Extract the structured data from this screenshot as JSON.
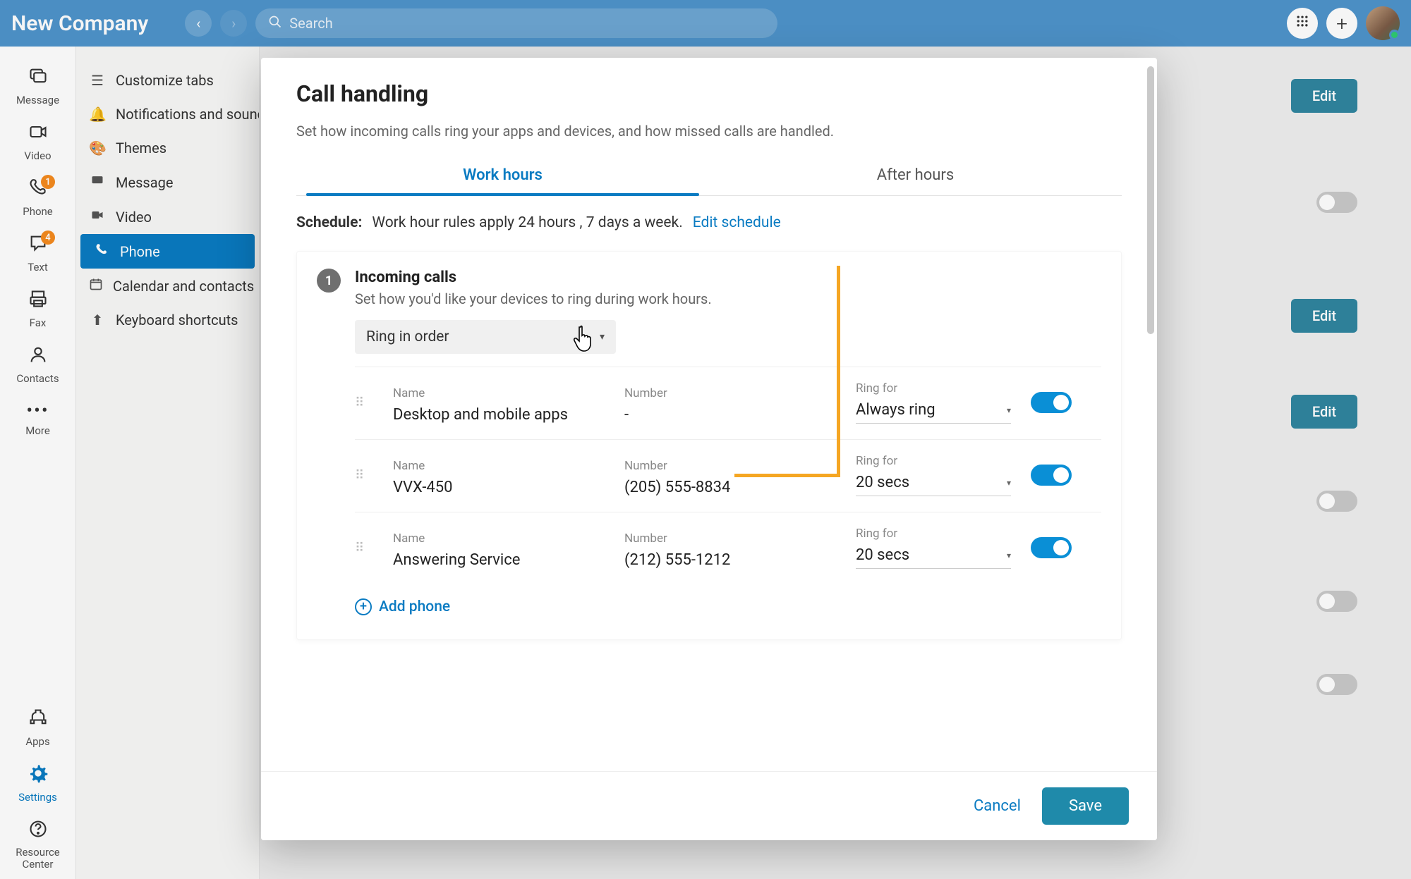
{
  "colors": {
    "accent": "#0a7bc2",
    "header": "#4f94cb",
    "warning": "#f58b1f",
    "highlight": "#f5a623"
  },
  "header": {
    "company_name": "New Company",
    "search_placeholder": "Search"
  },
  "rail": {
    "items": [
      {
        "id": "message",
        "label": "Message",
        "badge": null
      },
      {
        "id": "video",
        "label": "Video",
        "badge": null
      },
      {
        "id": "phone",
        "label": "Phone",
        "badge": "1"
      },
      {
        "id": "text",
        "label": "Text",
        "badge": "4"
      },
      {
        "id": "fax",
        "label": "Fax",
        "badge": null
      },
      {
        "id": "contacts",
        "label": "Contacts",
        "badge": null
      },
      {
        "id": "more",
        "label": "More",
        "badge": null
      }
    ],
    "bottom": [
      {
        "id": "apps",
        "label": "Apps"
      },
      {
        "id": "settings",
        "label": "Settings"
      },
      {
        "id": "resource",
        "label": "Resource Center"
      }
    ]
  },
  "sidebar": {
    "items": [
      {
        "label": "Customize tabs"
      },
      {
        "label": "Notifications and sounds"
      },
      {
        "label": "Themes"
      },
      {
        "label": "Message"
      },
      {
        "label": "Video"
      },
      {
        "label": "Phone"
      },
      {
        "label": "Calendar and contacts"
      },
      {
        "label": "Keyboard shortcuts"
      }
    ],
    "active_index": 5
  },
  "bg_page": {
    "edit_label": "Edit"
  },
  "modal": {
    "title": "Call handling",
    "subtitle": "Set how incoming calls ring your apps and devices, and how missed calls are handled.",
    "tabs": [
      {
        "id": "work",
        "label": "Work hours"
      },
      {
        "id": "after",
        "label": "After hours"
      }
    ],
    "active_tab": 0,
    "schedule": {
      "label": "Schedule:",
      "text": "Work hour rules apply 24 hours , 7 days a week.",
      "link": "Edit schedule"
    },
    "section1": {
      "step": "1",
      "title": "Incoming calls",
      "desc": "Set how you'd like your devices to ring during work hours.",
      "ring_mode": "Ring in order",
      "columns": {
        "name": "Name",
        "number": "Number",
        "ringfor": "Ring for"
      },
      "devices": [
        {
          "name": "Desktop and mobile apps",
          "number": "-",
          "ringfor": "Always ring",
          "enabled": true
        },
        {
          "name": "VVX-450",
          "number": "(205) 555-8834",
          "ringfor": "20 secs",
          "enabled": true
        },
        {
          "name": "Answering Service",
          "number": "(212) 555-1212",
          "ringfor": "20 secs",
          "enabled": true
        }
      ],
      "add_phone": "Add phone"
    },
    "footer": {
      "cancel": "Cancel",
      "save": "Save"
    }
  }
}
